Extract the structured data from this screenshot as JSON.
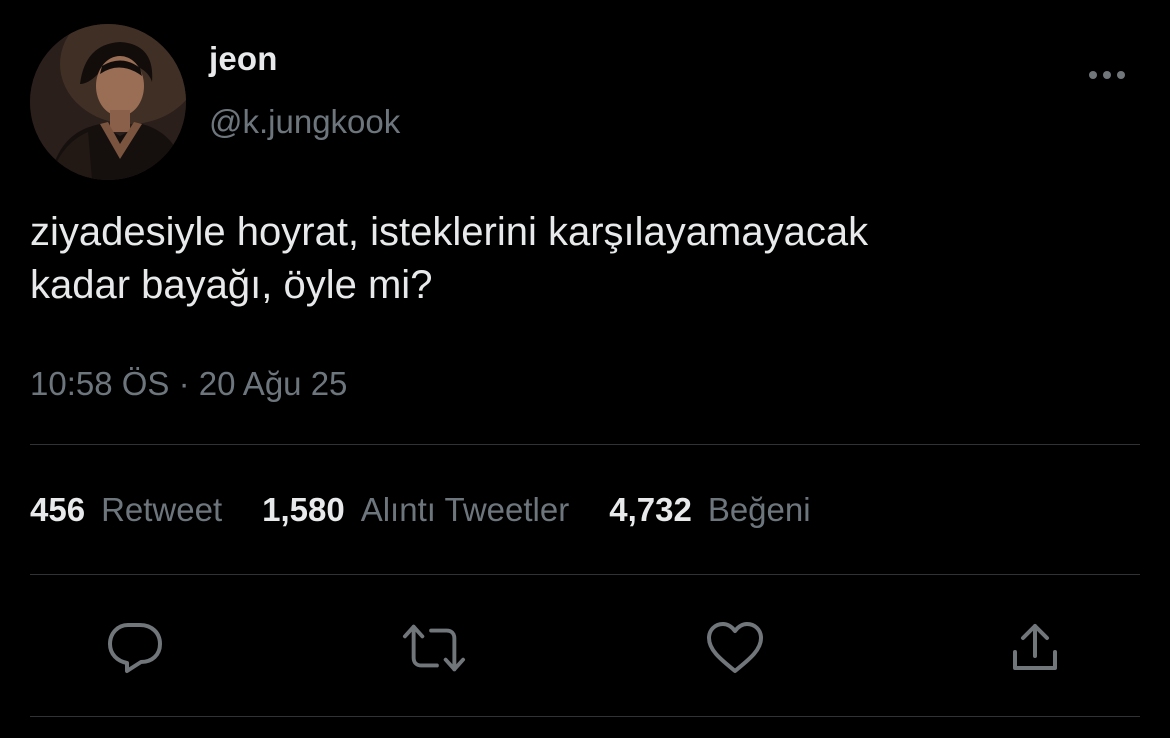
{
  "author": {
    "name": "jeon",
    "handle": "@k.jungkook",
    "avatar_icon": "profile-photo"
  },
  "tweet": {
    "lines": [
      "ziyadesiyle hoyrat, isteklerini karşılayamayacak",
      "kadar bayağı, öyle mi?"
    ],
    "timestamp": "10:58 ÖS · 20 Ağu 25"
  },
  "stats": {
    "retweets": {
      "count": "456",
      "label": "Retweet"
    },
    "quotes": {
      "count": "1,580",
      "label": "Alıntı Tweetler"
    },
    "likes": {
      "count": "4,732",
      "label": "Beğeni"
    }
  },
  "actions": {
    "reply_icon": "reply-icon",
    "retweet_icon": "retweet-icon",
    "like_icon": "heart-icon",
    "share_icon": "share-icon",
    "more_icon": "more-icon"
  },
  "colors": {
    "background": "#000000",
    "primary_text": "#e7e9ea",
    "secondary_text": "#6e767d",
    "icon": "#71767b",
    "divider": "#2f3336"
  }
}
